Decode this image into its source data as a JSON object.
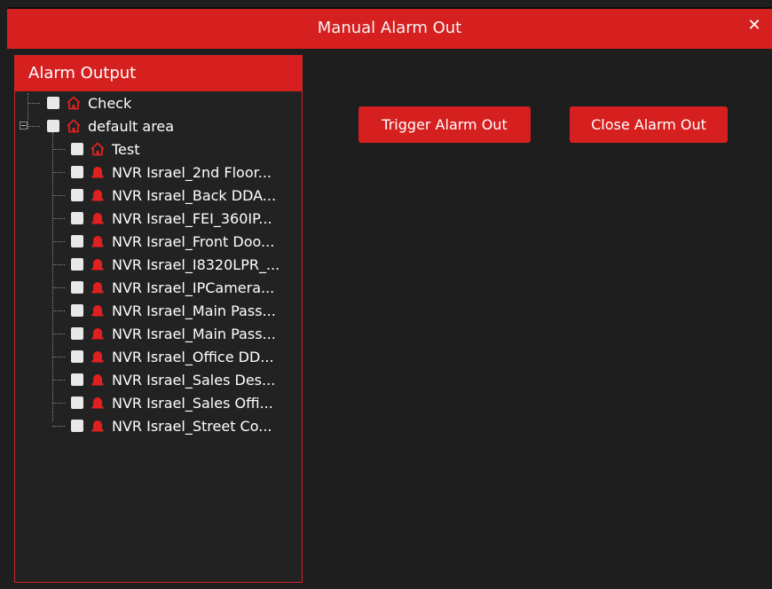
{
  "window": {
    "title": "Manual Alarm Out"
  },
  "panel": {
    "header": "Alarm Output"
  },
  "tree": {
    "top": [
      {
        "label": "Check",
        "icon": "home-icon"
      },
      {
        "label": "default area",
        "icon": "home-icon"
      }
    ],
    "children": [
      {
        "label": "Test",
        "icon": "home-icon"
      },
      {
        "label": "NVR Israel_2nd Floor...",
        "icon": "alarm-bell-icon"
      },
      {
        "label": "NVR Israel_Back DDA...",
        "icon": "alarm-bell-icon"
      },
      {
        "label": "NVR Israel_FEI_360IP...",
        "icon": "alarm-bell-icon"
      },
      {
        "label": "NVR Israel_Front Doo...",
        "icon": "alarm-bell-icon"
      },
      {
        "label": "NVR Israel_I8320LPR_...",
        "icon": "alarm-bell-icon"
      },
      {
        "label": "NVR Israel_IPCamera...",
        "icon": "alarm-bell-icon"
      },
      {
        "label": "NVR Israel_Main Pass...",
        "icon": "alarm-bell-icon"
      },
      {
        "label": "NVR Israel_Main Pass...",
        "icon": "alarm-bell-icon"
      },
      {
        "label": "NVR Israel_Office DD...",
        "icon": "alarm-bell-icon"
      },
      {
        "label": "NVR Israel_Sales Des...",
        "icon": "alarm-bell-icon"
      },
      {
        "label": "NVR Israel_Sales Offi...",
        "icon": "alarm-bell-icon"
      },
      {
        "label": "NVR Israel_Street Co...",
        "icon": "alarm-bell-icon"
      }
    ]
  },
  "actions": {
    "trigger": "Trigger Alarm Out",
    "close": "Close Alarm Out"
  },
  "colors": {
    "accent": "#d62020",
    "background": "#1e1e1e",
    "icon": "#e02020"
  }
}
